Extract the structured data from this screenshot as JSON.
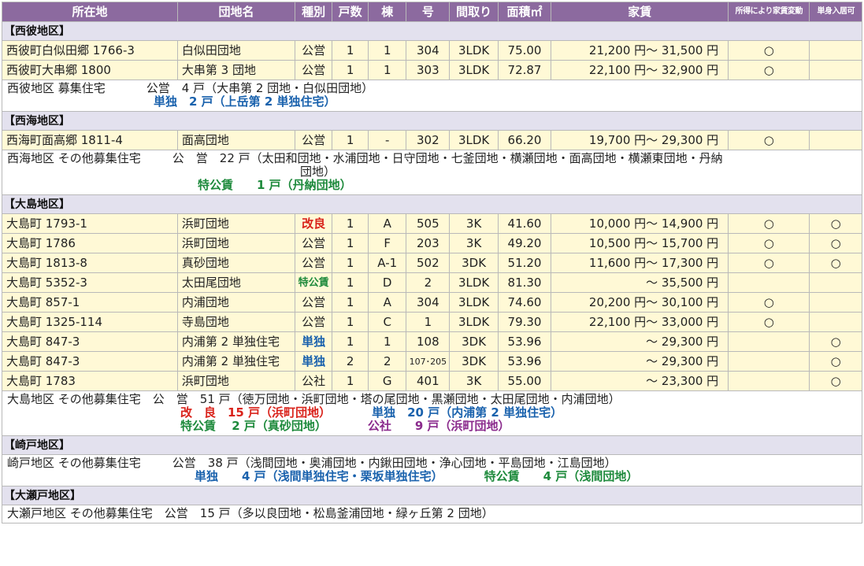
{
  "headers": [
    "所在地",
    "団地名",
    "種別",
    "戸数",
    "棟",
    "号",
    "間取り",
    "面積㎡",
    "家賃",
    "所得により家賃変動",
    "単身入居可"
  ],
  "sections": {
    "nishisonogi": {
      "title": "【西彼地区】",
      "rows": [
        {
          "addr": "西彼町白似田郷 1766-3",
          "name": "白似田団地",
          "type": "公営",
          "units": "1",
          "bldg": "1",
          "no": "304",
          "layout": "3LDK",
          "area": "75.00",
          "rent": "21,200 円～ 31,500 円",
          "income": "○",
          "single": ""
        },
        {
          "addr": "西彼町大串郷 1800",
          "name": "大串第 3 団地",
          "type": "公営",
          "units": "1",
          "bldg": "1",
          "no": "303",
          "layout": "3LDK",
          "area": "72.87",
          "rent": "22,100 円～ 32,900 円",
          "income": "○",
          "single": ""
        }
      ],
      "summary_head": "西彼地区 募集住宅",
      "summary_l1": "公営　4 戸（大串第 2 団地・白似田団地）",
      "summary_l2": "単独　2 戸（上岳第 2 単独住宅）"
    },
    "saikai": {
      "title": "【西海地区】",
      "rows": [
        {
          "addr": "西海町面高郷 1811-4",
          "name": "面高団地",
          "type": "公営",
          "units": "1",
          "bldg": "-",
          "no": "302",
          "layout": "3LDK",
          "area": "66.20",
          "rent": "19,700 円～ 29,300 円",
          "income": "○",
          "single": ""
        }
      ],
      "summary_head": "西海地区 その他募集住宅",
      "summary_l1": "公　営　22 戸（太田和団地・水浦団地・日守団地・七釜団地・横瀬団地・面高団地・横瀬東団地・丹納",
      "summary_l1b": "団地）",
      "summary_l2": "特公賃　　1 戸（丹納団地）"
    },
    "oshima": {
      "title": "【大島地区】",
      "rows": [
        {
          "addr": "大島町 1793-1",
          "name": "浜町団地",
          "type": "改良",
          "units": "1",
          "bldg": "A",
          "no": "505",
          "layout": "3K",
          "area": "41.60",
          "rent": "10,000 円～ 14,900 円",
          "income": "○",
          "single": "○"
        },
        {
          "addr": "大島町 1786",
          "name": "浜町団地",
          "type": "公営",
          "units": "1",
          "bldg": "F",
          "no": "203",
          "layout": "3K",
          "area": "49.20",
          "rent": "10,500 円～ 15,700 円",
          "income": "○",
          "single": "○"
        },
        {
          "addr": "大島町 1813-8",
          "name": "真砂団地",
          "type": "公営",
          "units": "1",
          "bldg": "A-1",
          "no": "502",
          "layout": "3DK",
          "area": "51.20",
          "rent": "11,600 円～ 17,300 円",
          "income": "○",
          "single": "○"
        },
        {
          "addr": "大島町 5352-3",
          "name": "太田尾団地",
          "type": "特公賃",
          "units": "1",
          "bldg": "D",
          "no": "2",
          "layout": "3LDK",
          "area": "81.30",
          "rent": "～ 35,500 円",
          "income": "",
          "single": ""
        },
        {
          "addr": "大島町 857-1",
          "name": "内浦団地",
          "type": "公営",
          "units": "1",
          "bldg": "A",
          "no": "304",
          "layout": "3LDK",
          "area": "74.60",
          "rent": "20,200 円～ 30,100 円",
          "income": "○",
          "single": ""
        },
        {
          "addr": "大島町 1325-114",
          "name": "寺島団地",
          "type": "公営",
          "units": "1",
          "bldg": "C",
          "no": "1",
          "layout": "3LDK",
          "area": "79.30",
          "rent": "22,100 円～ 33,000 円",
          "income": "○",
          "single": ""
        },
        {
          "addr": "大島町 847-3",
          "name": "内浦第 2 単独住宅",
          "type": "単独",
          "units": "1",
          "bldg": "1",
          "no": "108",
          "layout": "3DK",
          "area": "53.96",
          "rent": "～ 29,300 円",
          "income": "",
          "single": "○"
        },
        {
          "addr": "大島町 847-3",
          "name": "内浦第 2 単独住宅",
          "type": "単独",
          "units": "2",
          "bldg": "2",
          "no": "107･205",
          "layout": "3DK",
          "area": "53.96",
          "rent": "～ 29,300 円",
          "income": "",
          "single": "○"
        },
        {
          "addr": "大島町 1783",
          "name": "浜町団地",
          "type": "公社",
          "units": "1",
          "bldg": "G",
          "no": "401",
          "layout": "3K",
          "area": "55.00",
          "rent": "～ 23,300 円",
          "income": "",
          "single": "○"
        }
      ],
      "summary_head": "大島地区 その他募集住宅",
      "summary_l1": "公　営　51 戸（徳万団地・浜町団地・塔の尾団地・黒瀬団地・太田尾団地・内浦団地）",
      "summary_l2a": "改　良　15 戸（浜町団地）",
      "summary_l2b": "単独　20 戸（内浦第 2 単独住宅）",
      "summary_l3a": "特公賃　 2 戸（真砂団地）",
      "summary_l3b": "公社　　9 戸（浜町団地）"
    },
    "sakito": {
      "title": "【崎戸地区】",
      "summary_head": "崎戸地区 その他募集住宅",
      "summary_l1": "公営　38 戸（浅間団地・奥浦団地・内鍬田団地・浄心団地・平島団地・江島団地）",
      "summary_l2a": "単独　　4 戸（浅間単独住宅・栗坂単独住宅）",
      "summary_l2b": "特公賃　　4 戸（浅間団地）"
    },
    "oseto": {
      "title": "【大瀬戸地区】",
      "summary_head": "大瀬戸地区 その他募集住宅",
      "summary_l1": "公営　15 戸（多以良団地・松島釜浦団地・緑ヶ丘第 2 団地）"
    }
  },
  "colors": {
    "header_bg": "#8c6a9f",
    "section_bg": "#e3e1ee",
    "row_bg": "#fff9d6",
    "red": "#d9231b",
    "green": "#1e8a3c",
    "blue": "#1a62ad",
    "purple": "#8a2a8c"
  }
}
